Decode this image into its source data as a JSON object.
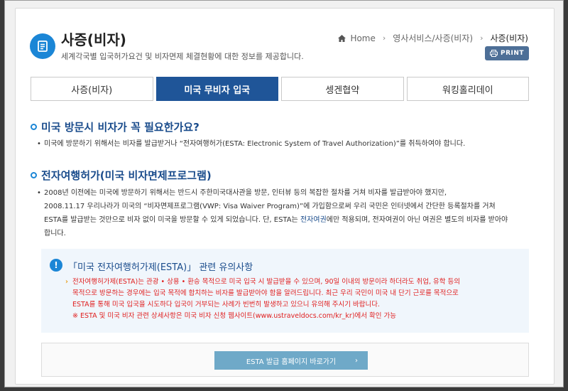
{
  "header": {
    "title": "사증(비자)",
    "description": "세계각국별 입국허가요건 및 비자면제 체결현황에 대한 정보를 제공합니다.",
    "print_label": "PRINT"
  },
  "breadcrumb": {
    "home": "Home",
    "items": [
      "영사서비스/사증(비자)",
      "사증(비자)"
    ]
  },
  "tabs": [
    {
      "label": "사증(비자)",
      "active": false
    },
    {
      "label": "미국 무비자 입국",
      "active": true
    },
    {
      "label": "셍겐협약",
      "active": false
    },
    {
      "label": "워킹홀리데이",
      "active": false
    }
  ],
  "section1": {
    "heading": "미국 방문시 비자가 꼭 필요한가요?",
    "text": "미국에 방문하기 위해서는 비자를 발급받거나 “전자여행허가(ESTA: Electronic System of Travel Authorization)”를 취득하여야 합니다."
  },
  "section2": {
    "heading": "전자여행허가(미국 비자면제프로그램)",
    "line1": "2008년 이전에는 미국에 방문하기 위해서는 반드시 주한미국대사관을 방문, 인터뷰 등의 복잡한 절차를 거쳐 비자를 발급받아야 했지만,",
    "line2": "2008.11.17 우리나라가 미국의 “비자면제프로그램(VWP: Visa Waiver Program)”에 가입함으로써 우리 국민은 인터넷에서 간단한 등록절차를 거쳐",
    "line3_pre": "ESTA를 발급받는 것만으로 비자 없이 미국을 방문할 수 있게 되었습니다. 단, ESTA는 ",
    "line3_link": "전자여권",
    "line3_post": "에만 적용되며, 전자여권이 아닌 여권은 별도의 비자를 받아야",
    "line4": "합니다."
  },
  "notice": {
    "icon": "!",
    "title": "「미국 전자여행허가제(ESTA)」 관련 유의사항",
    "line1": "전자여행허가제(ESTA)는 관광 • 상용 • 환승 목적으로 미국 입국 시 발급받을 수 있으며, 90일 이내의 방문이라 하더라도 취업, 유학 등의",
    "line2": "목적으로 방문하는 경우에는 입국 목적에 합치하는 비자를 발급받아야 함을 알려드립니다. 최근 우리 국민이 미국 내 단기 근로를 목적으로",
    "line3": "ESTA를 통해 미국 입국을 시도하다 입국이 거부되는 사례가 빈번히 발생하고 있으니 유의해 주시기 바랍니다.",
    "line4": "※ ESTA 및 미국 비자 관련 상세사항은 미국 비자 신청 웹사이트(www.ustraveldocs.com/kr_kr)에서 확인 가능"
  },
  "cta": {
    "label": "ESTA 발급 홈페이지 바로가기",
    "chevron": "›"
  },
  "colors": {
    "accent": "#1b86d6",
    "tab_active": "#1f5598",
    "heading": "#1a4c8c",
    "warning": "#e02020",
    "cta": "#6fa9c8"
  }
}
